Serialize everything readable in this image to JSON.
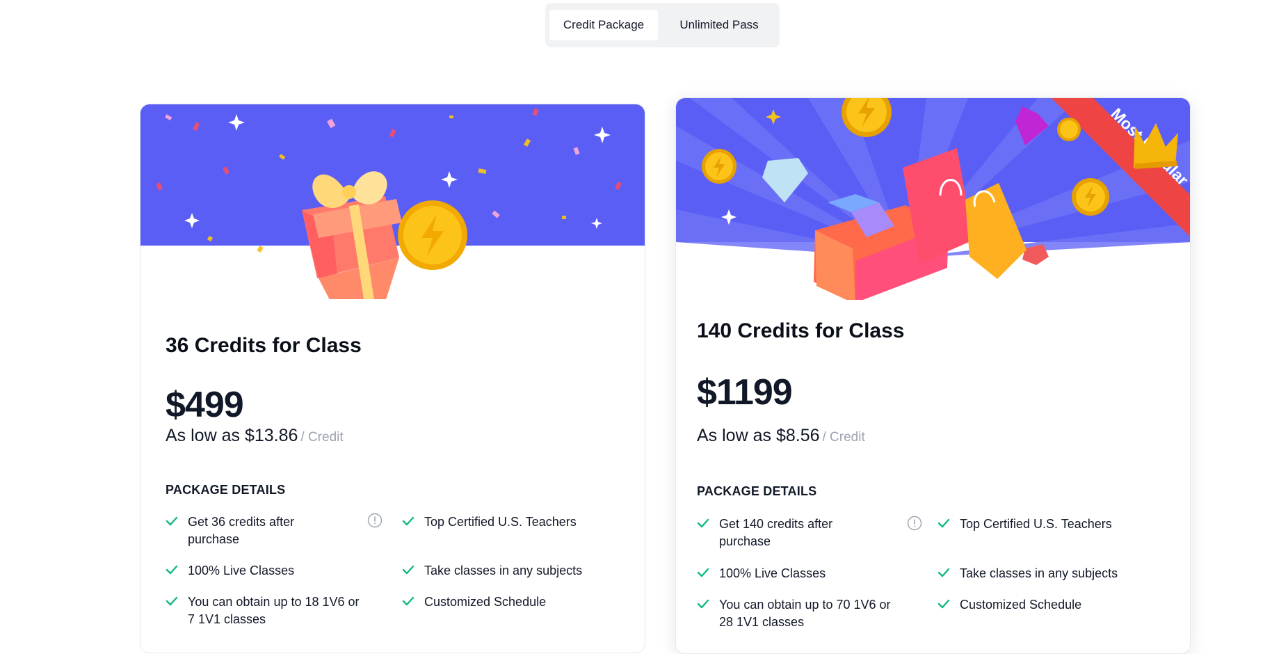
{
  "tabs": {
    "credit_package": "Credit Package",
    "unlimited_pass": "Unlimited Pass"
  },
  "colors": {
    "banner": "#5b5ef5",
    "check": "#10b981",
    "ribbon": "#ef4444",
    "coin": "#f5b50a"
  },
  "plans": [
    {
      "title": "36 Credits for Class",
      "price": "$499",
      "low_prefix": "As low as ",
      "low_amount": "$13.86",
      "unit": "/ Credit",
      "details_heading": "PACKAGE DETAILS",
      "features_left": [
        "Get 36 credits after purchase",
        "100% Live Classes",
        "You can obtain up to 18 1V6 or 7 1V1 classes"
      ],
      "features_right": [
        "Top Certified U.S. Teachers",
        "Take classes in any subjects",
        "Customized Schedule"
      ]
    },
    {
      "title": "140 Credits for Class",
      "price": "$1199",
      "low_prefix": "As low as ",
      "low_amount": "$8.56",
      "unit": "/ Credit",
      "details_heading": "PACKAGE DETAILS",
      "badge": "Most Popular",
      "features_left": [
        "Get 140 credits after purchase",
        "100% Live Classes",
        "You can obtain up to 70 1V6 or 28 1V1 classes"
      ],
      "features_right": [
        "Top Certified U.S. Teachers",
        "Take classes in any subjects",
        "Customized Schedule"
      ]
    }
  ],
  "icons": {
    "check": "check-icon",
    "info": "info-icon",
    "gift": "gift-icon",
    "coin": "coin-icon",
    "crown": "crown-icon",
    "diamond": "diamond-icon",
    "bag": "shopping-bag-icon"
  }
}
